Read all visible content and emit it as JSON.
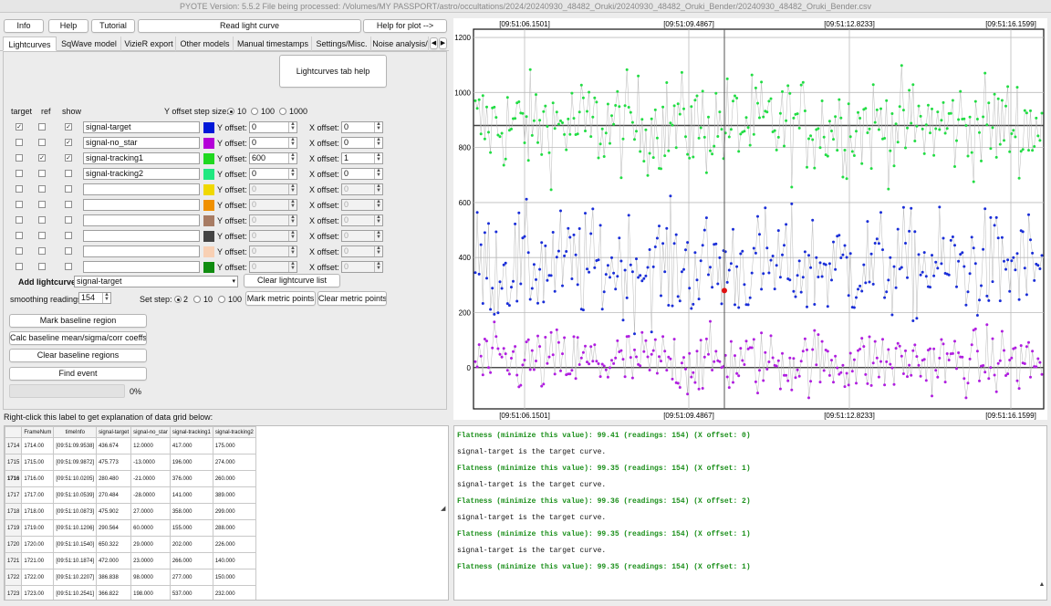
{
  "window_title": "PYOTE Version: 5.5.2  File being processed: /Volumes/MY PASSPORT/astro/occultations/2024/20240930_48482_Oruki/20240930_48482_Oruki_Bender/20240930_48482_Oruki_Bender.csv",
  "top_buttons": {
    "info": "Info",
    "help": "Help",
    "tutorial": "Tutorial",
    "read": "Read light curve",
    "plot_help": "Help for plot -->"
  },
  "tabs": [
    "Lightcurves",
    "SqWave model",
    "VizieR export",
    "Other models",
    "Manual timestamps",
    "Settings/Misc.",
    "Noise analysis/"
  ],
  "tab_help_button": "Lightcurves tab help",
  "header": {
    "target": "target",
    "ref": "ref",
    "show": "show",
    "yoffset_step": "Y offset step size:",
    "step_options": [
      "10",
      "100",
      "1000"
    ]
  },
  "rows": [
    {
      "target": true,
      "ref": false,
      "show": true,
      "name": "signal-target",
      "color": "#0018d8",
      "y_label": "Y offset:",
      "y_offset": "0",
      "x_label": "X offset:",
      "x_offset": "0"
    },
    {
      "target": false,
      "ref": false,
      "show": true,
      "name": "signal-no_star",
      "color": "#b400d8",
      "y_label": "Y offset:",
      "y_offset": "0",
      "x_label": "X offset:",
      "x_offset": "0"
    },
    {
      "target": false,
      "ref": true,
      "show": true,
      "name": "signal-tracking1",
      "color": "#20d820",
      "y_label": "Y offset:",
      "y_offset": "600",
      "x_label": "X offset:",
      "x_offset": "1"
    },
    {
      "target": false,
      "ref": false,
      "show": false,
      "name": "signal-tracking2",
      "color": "#20e880",
      "y_label": "Y offset:",
      "y_offset": "0",
      "x_label": "X offset:",
      "x_offset": "0"
    },
    {
      "target": false,
      "ref": false,
      "show": false,
      "name": "",
      "color": "#f0d800",
      "y_label": "Y offset:",
      "y_offset": "0",
      "x_label": "X offset:",
      "x_offset": "0"
    },
    {
      "target": false,
      "ref": false,
      "show": false,
      "name": "",
      "color": "#f09000",
      "y_label": "Y offset:",
      "y_offset": "0",
      "x_label": "X offset:",
      "x_offset": "0"
    },
    {
      "target": false,
      "ref": false,
      "show": false,
      "name": "",
      "color": "#a87c64",
      "y_label": "Y offset:",
      "y_offset": "0",
      "x_label": "X offset:",
      "x_offset": "0"
    },
    {
      "target": false,
      "ref": false,
      "show": false,
      "name": "",
      "color": "#444444",
      "y_label": "Y offset:",
      "y_offset": "0",
      "x_label": "X offset:",
      "x_offset": "0"
    },
    {
      "target": false,
      "ref": false,
      "show": false,
      "name": "",
      "color": "#f8d0b4",
      "y_label": "Y offset:",
      "y_offset": "0",
      "x_label": "X offset:",
      "x_offset": "0"
    },
    {
      "target": false,
      "ref": false,
      "show": false,
      "name": "",
      "color": "#108c10",
      "y_label": "Y offset:",
      "y_offset": "0",
      "x_label": "X offset:",
      "x_offset": "0"
    }
  ],
  "add_lightcurve": {
    "label": "Add lightcurve",
    "value": "signal-target",
    "clear": "Clear lightcurve list"
  },
  "smoothing": {
    "label": "smoothing readings",
    "value": "154",
    "set_step": "Set step:",
    "step_options": [
      "2",
      "10",
      "100"
    ],
    "mark_metric": "Mark metric points",
    "clear_metric": "Clear metric points"
  },
  "actions": [
    "Mark baseline region",
    "Calc baseline mean/sigma/corr coeffs",
    "Clear baseline regions",
    "Find event"
  ],
  "progress": {
    "label": "0%",
    "fraction": 0
  },
  "grid_label": "Right-click this label to get explanation of data grid below:",
  "grid": {
    "columns": [
      "FrameNum",
      "timeInfo",
      "signal-target",
      "signal-no_star",
      "signal-tracking1",
      "signal-tracking2"
    ],
    "rows": [
      [
        "1714",
        "1714.00",
        "[09:51:09.9538]",
        "436.674",
        "12.0000",
        "417.000",
        "175.000"
      ],
      [
        "1715",
        "1715.00",
        "[09:51:09.9872]",
        "475.773",
        "-13.0000",
        "196.000",
        "274.000"
      ],
      [
        "1716",
        "1716.00",
        "[09:51:10.0205]",
        "280.480",
        "-21.0000",
        "376.000",
        "260.000"
      ],
      [
        "1717",
        "1717.00",
        "[09:51:10.0539]",
        "270.484",
        "-28.0000",
        "141.000",
        "389.000"
      ],
      [
        "1718",
        "1718.00",
        "[09:51:10.0873]",
        "475.902",
        "27.0000",
        "358.000",
        "299.000"
      ],
      [
        "1719",
        "1719.00",
        "[09:51:10.1206]",
        "290.564",
        "60.0000",
        "155.000",
        "288.000"
      ],
      [
        "1720",
        "1720.00",
        "[09:51:10.1540]",
        "650.322",
        "29.0000",
        "202.000",
        "226.000"
      ],
      [
        "1721",
        "1721.00",
        "[09:51:10.1874]",
        "472.000",
        "23.0000",
        "266.000",
        "140.000"
      ],
      [
        "1722",
        "1722.00",
        "[09:51:10.2207]",
        "386.838",
        "98.0000",
        "277.000",
        "150.000"
      ],
      [
        "1723",
        "1723.00",
        "[09:51:10.2541]",
        "366.822",
        "198.000",
        "537.000",
        "232.000"
      ]
    ]
  },
  "text_output": [
    {
      "text": "Flatness (minimize this value): 99.41 (readings: 154) (X offset: 0)",
      "style": "g"
    },
    {
      "text": "signal-target is the target curve.",
      "style": ""
    },
    {
      "text": "Flatness (minimize this value): 99.35 (readings: 154) (X offset: 1)",
      "style": "g"
    },
    {
      "text": "signal-target is the target curve.",
      "style": ""
    },
    {
      "text": "Flatness (minimize this value): 99.36 (readings: 154) (X offset: 2)",
      "style": "g"
    },
    {
      "text": "signal-target is the target curve.",
      "style": ""
    },
    {
      "text": "Flatness (minimize this value): 99.35 (readings: 154) (X offset: 1)",
      "style": "g"
    },
    {
      "text": "signal-target is the target curve.",
      "style": ""
    },
    {
      "text": "Flatness (minimize this value): 99.35 (readings: 154) (X offset: 1)",
      "style": "g"
    }
  ],
  "plot": {
    "top_ticks": [
      "[09:51:06.1501]",
      "[09:51:09.4867]",
      "[09:51:12.8233]",
      "[09:51:16.1599]"
    ],
    "bottom_ticks": [
      "[09:51:06.1501]",
      "[09:51:09.4867]",
      "[09:51:12.8233]",
      "[09:51:16.1599]"
    ],
    "y_ticks": [
      "1200",
      "1000",
      "800",
      "600",
      "400",
      "200",
      "0"
    ],
    "y_range": [
      -150,
      1230
    ],
    "series": [
      {
        "color": "#22dd44",
        "mean": 880,
        "sd": 90
      },
      {
        "color": "#1a2ed8",
        "mean": 370,
        "sd": 100
      },
      {
        "color": "#b01ee0",
        "mean": 20,
        "sd": 60
      }
    ],
    "mean_line_value": 880,
    "red_point_value": 280,
    "cursor_label": "[09:51:09.4867]"
  }
}
